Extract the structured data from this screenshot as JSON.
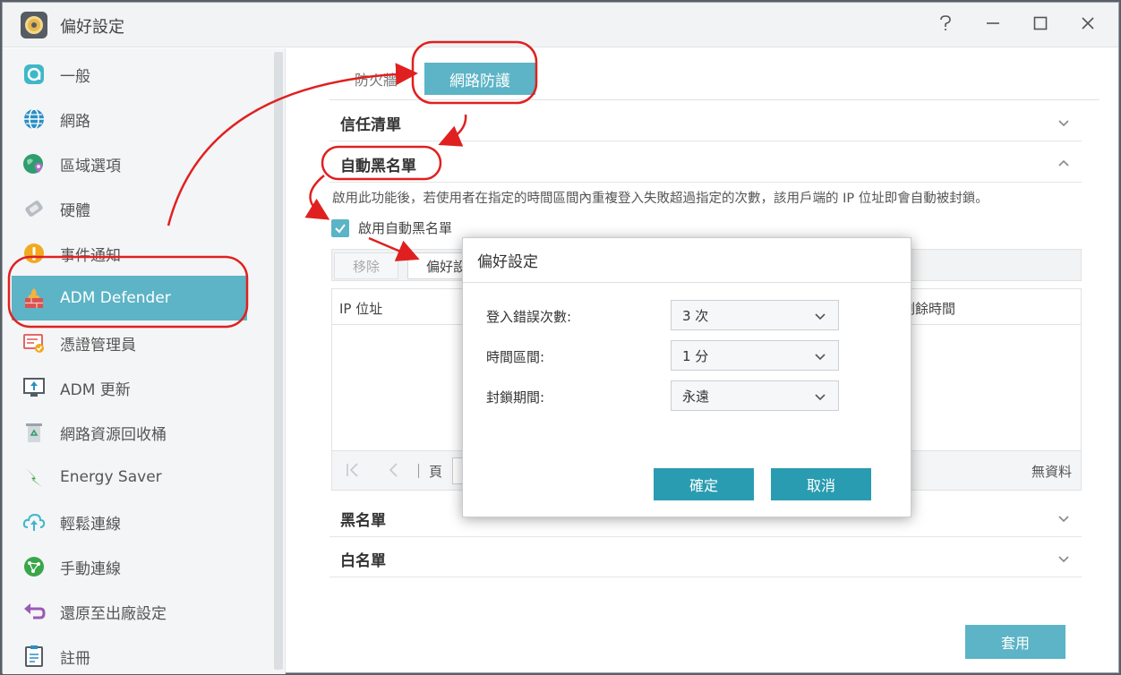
{
  "window": {
    "title": "偏好設定"
  },
  "sidebar": {
    "items": [
      {
        "label": "一般"
      },
      {
        "label": "網路"
      },
      {
        "label": "區域選項"
      },
      {
        "label": "硬體"
      },
      {
        "label": "事件通知"
      },
      {
        "label": "ADM Defender"
      },
      {
        "label": "憑證管理員"
      },
      {
        "label": "ADM 更新"
      },
      {
        "label": "網路資源回收桶"
      },
      {
        "label": "Energy Saver"
      },
      {
        "label": "輕鬆連線"
      },
      {
        "label": "手動連線"
      },
      {
        "label": "還原至出廠設定"
      },
      {
        "label": "註冊"
      }
    ],
    "active_index": 5
  },
  "tabs": [
    {
      "label": "防火牆"
    },
    {
      "label": "網路防護"
    }
  ],
  "sections": {
    "trust": "信任清單",
    "auto_black": "自動黑名單",
    "black": "黑名單",
    "white": "白名單"
  },
  "auto_black": {
    "description": "啟用此功能後，若使用者在指定的時間區間內重複登入失敗超過指定的次數，該用戶端的 IP 位址即會自動被封鎖。",
    "enable_label": "啟用自動黑名單",
    "enabled": true,
    "remove_label": "移除",
    "pref_label": "偏好設",
    "col_ip": "IP 位址",
    "col_time": "剩餘時間",
    "page_label": "頁",
    "no_data": "無資料"
  },
  "dialog": {
    "title": "偏好設定",
    "fields": [
      {
        "label": "登入錯誤次數:",
        "value": "3 次"
      },
      {
        "label": "時間區間:",
        "value": "1 分"
      },
      {
        "label": "封鎖期間:",
        "value": "永遠"
      }
    ],
    "ok_label": "確定",
    "cancel_label": "取消"
  },
  "apply_label": "套用",
  "colors": {
    "accent": "#5cb4c6",
    "dialog_button": "#2a9cb1",
    "annotation": "#e02020"
  }
}
